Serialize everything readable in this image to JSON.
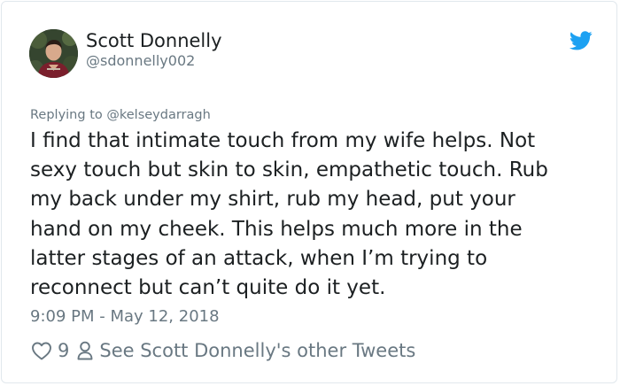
{
  "author": {
    "name": "Scott Donnelly",
    "handle": "@sdonnelly002"
  },
  "reply": {
    "prefix": "Replying to",
    "mention": "@kelseydarragh"
  },
  "tweet": {
    "lines": [
      "I find that intimate touch from my wife helps. Not",
      "sexy touch but skin to skin, empathetic touch. Rub",
      "my back under my shirt, rub my head, put your",
      "hand on my cheek. This helps much more in the",
      "latter stages of an attack, when I’m trying to",
      "reconnect but can’t quite do it yet."
    ],
    "timestamp": "9:09 PM - May 12, 2018"
  },
  "actions": {
    "likes": "9",
    "profile_link": "See Scott Donnelly's other Tweets"
  },
  "icons": {
    "brand": "twitter-bird-icon",
    "like": "heart-icon",
    "profile": "person-icon"
  },
  "colors": {
    "brand": "#1da1f2",
    "text": "#1c2022",
    "muted": "#697882",
    "border": "#e1e8ed"
  }
}
